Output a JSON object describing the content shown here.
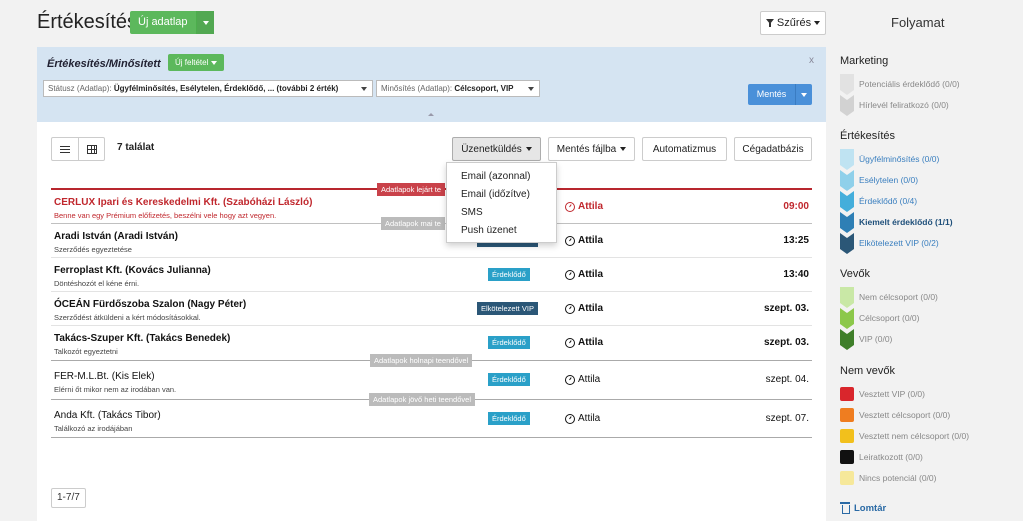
{
  "header": {
    "title": "Értékesítés",
    "new_button": "Új adatlap",
    "filter_button": "Szűrés"
  },
  "filter_panel": {
    "title": "Értékesítés/Minősített",
    "new_condition": "Új feltétel",
    "close": "x",
    "status_select": {
      "label": "Státusz (Adatlap):",
      "value": "Ügyfélminősítés, Esélytelen, Érdeklődő, ... (további 2 érték)"
    },
    "rating_select": {
      "label": "Minősítés (Adatlap):",
      "value": "Célcsoport, VIP"
    },
    "save_button": "Mentés"
  },
  "toolbar": {
    "result_count": "7 találat",
    "messaging": "Üzenetküldés",
    "save_to_file": "Mentés fájlba",
    "automation": "Automatizmus",
    "company_db": "Cégadatbázis"
  },
  "messaging_menu": [
    "Email (azonnal)",
    "Email (időzítve)",
    "SMS",
    "Push üzenet"
  ],
  "groups": {
    "late": "Adatlapok lejárt te",
    "today": "Adatlapok mai te",
    "tomorrow": "Adatlapok holnapi teendővel",
    "next_week": "Adatlapok jövő heti teendővel"
  },
  "rows": [
    {
      "title": "CERLUX Ipari és Kereskedelmi Kft. (Szabóházi László)",
      "subtitle": "Benne van egy Prémium előfizetés, beszélni vele hogy azt vegyen.",
      "badge": "",
      "user": "Attila",
      "time": "09:00"
    },
    {
      "title": "Aradi István (Aradi István)",
      "subtitle": "Szerződés egyeztetése",
      "badge": "Elkötelezett VIP",
      "user": "Attila",
      "time": "13:25"
    },
    {
      "title": "Ferroplast Kft. (Kovács Julianna)",
      "subtitle": "Döntéshozót el kéne érni.",
      "badge": "Érdeklődő",
      "user": "Attila",
      "time": "13:40"
    },
    {
      "title": "ÓCEÁN Fürdőszoba Szalon (Nagy Péter)",
      "subtitle": "Szerződést átküldeni a kért módosításokkal.",
      "badge": "Elkötelezett VIP",
      "user": "Attila",
      "time": "szept. 03."
    },
    {
      "title": "Takács-Szuper Kft. (Takács Benedek)",
      "subtitle": "Talkozót egyeztetni",
      "badge": "Érdeklődő",
      "user": "Attila",
      "time": "szept. 03."
    },
    {
      "title": "FER-M.L.Bt. (Kis Elek)",
      "subtitle": "Elérni őt mikor nem az irodában van.",
      "badge": "Érdeklődő",
      "user": "Attila",
      "time": "szept. 04."
    },
    {
      "title": "Anda Kft. (Takács Tibor)",
      "subtitle": "Találkozó az irodájában",
      "badge": "Érdeklődő",
      "user": "Attila",
      "time": "szept. 07."
    }
  ],
  "pager": "1-7/7",
  "sidebar": {
    "title": "Folyamat",
    "groups": [
      {
        "title": "Marketing",
        "items": [
          {
            "label": "Potenciális érdeklődő (0/0)",
            "color": "#e2e2e2"
          },
          {
            "label": "Hírlevél feliratkozó (0/0)",
            "color": "#d2d2d2"
          }
        ]
      },
      {
        "title": "Értékesítés",
        "items": [
          {
            "label": "Ügyfélminősítés (0/0)",
            "color": "#bfe3f2"
          },
          {
            "label": "Esélytelen (0/0)",
            "color": "#8fd0ea"
          },
          {
            "label": "Érdeklődő (0/4)",
            "color": "#44aedb"
          },
          {
            "label": "Kiemelt érdeklődő (1/1)",
            "color": "#2e7fb5"
          },
          {
            "label": "Elkötelezett VIP (0/2)",
            "color": "#2b5777"
          }
        ]
      },
      {
        "title": "Vevők",
        "items": [
          {
            "label": "Nem célcsoport (0/0)",
            "color": "#c9e8a6"
          },
          {
            "label": "Célcsoport (0/0)",
            "color": "#8cc84a"
          },
          {
            "label": "VIP (0/0)",
            "color": "#3f7f2a"
          }
        ]
      },
      {
        "title": "Nem vevők",
        "items": [
          {
            "label": "Vesztett VIP (0/0)",
            "color": "#d9262c"
          },
          {
            "label": "Vesztett célcsoport (0/0)",
            "color": "#ef7d20"
          },
          {
            "label": "Vesztett nem célcsoport (0/0)",
            "color": "#f2c01c"
          },
          {
            "label": "Leiratkozott (0/0)",
            "color": "#111111"
          },
          {
            "label": "Nincs potenciál (0/0)",
            "color": "#f6e89a"
          }
        ]
      }
    ],
    "trash": "Lomtár"
  }
}
